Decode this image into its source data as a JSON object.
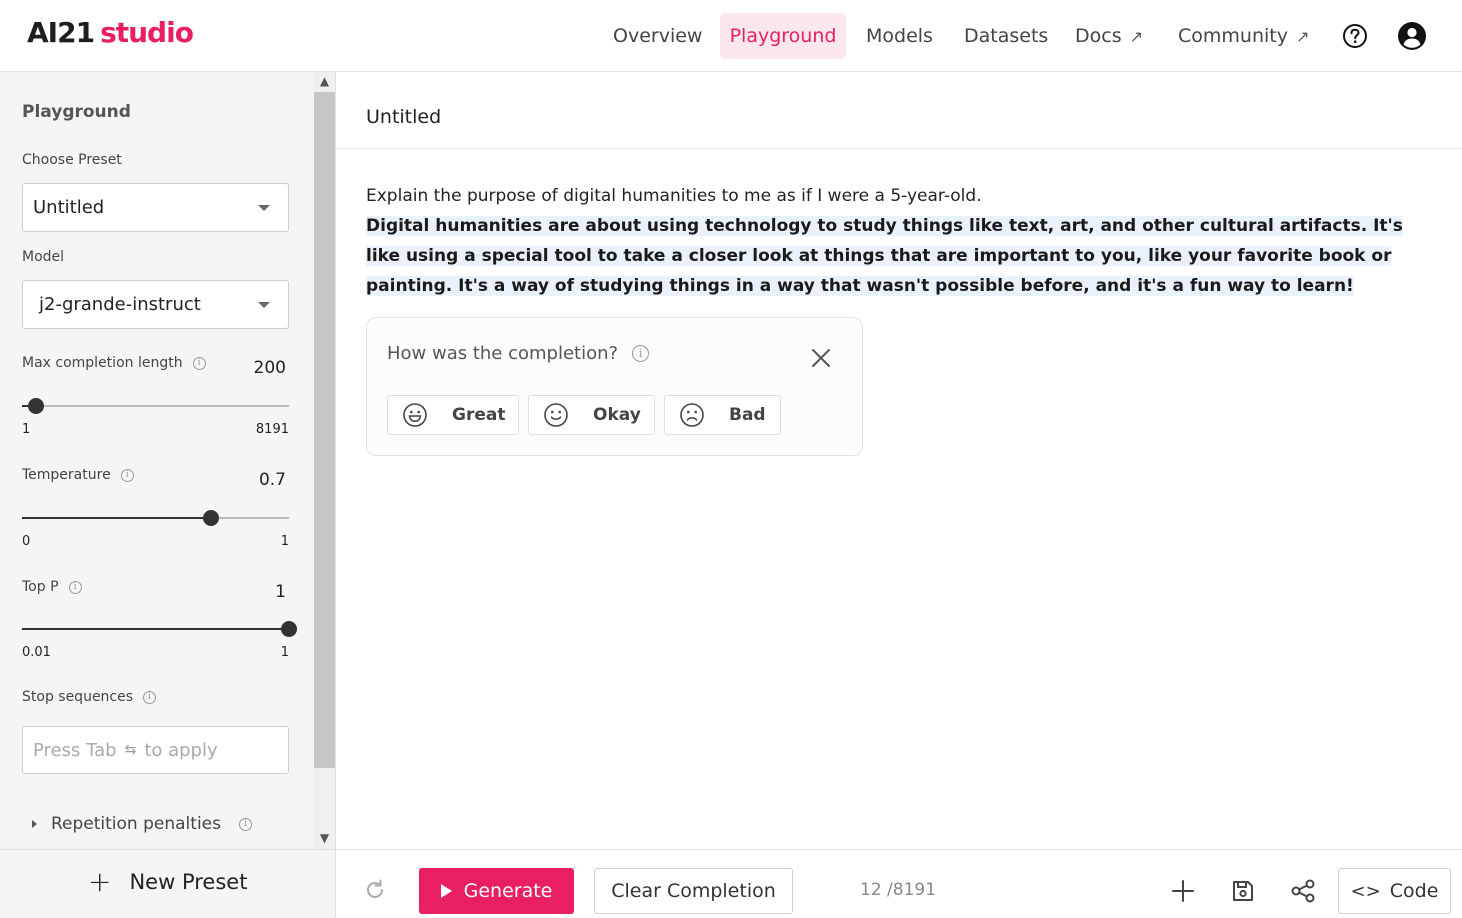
{
  "header": {
    "logo_ai": "AI21",
    "logo_studio": "studio",
    "nav": [
      {
        "label": "Overview",
        "active": false
      },
      {
        "label": "Playground",
        "active": true
      },
      {
        "label": "Models",
        "active": false
      },
      {
        "label": "Datasets",
        "active": false
      },
      {
        "label": "Docs",
        "active": false,
        "external": true
      },
      {
        "label": "Community",
        "active": false,
        "external": true
      }
    ],
    "icons": [
      "help-icon",
      "user-account-icon"
    ],
    "external_glyph": "↗"
  },
  "sidebar": {
    "title": "Playground",
    "preset_label": "Choose Preset",
    "preset_value": "Untitled",
    "model_label": "Model",
    "model_value": "j2-grande-instruct",
    "max_length": {
      "label": "Max completion length",
      "value": "200",
      "min": "1",
      "max": "8191",
      "level": 0.024
    },
    "temperature": {
      "label": "Temperature",
      "value": "0.7",
      "min": "0",
      "max": "1",
      "level": 0.7
    },
    "top_p": {
      "label": "Top P",
      "value": "1",
      "min": "0.01",
      "max": "1",
      "level": 1.0
    },
    "stop_sequences": {
      "label": "Stop sequences",
      "placeholder_pre": "Press Tab",
      "placeholder_post": "to apply"
    },
    "repetition_label": "Repetition penalties",
    "new_preset_label": "New Preset"
  },
  "main": {
    "title": "Untitled",
    "prompt": "Explain the purpose of digital humanities to me as if I were a 5-year-old.",
    "completion": "Digital humanities are about using technology to study things like text, art, and other cultural artifacts. It's like using a special tool to take a closer look at things that are important to you, like your favorite book or painting. It's a way of studying things in a way that wasn't possible before, and it's a fun way to learn!",
    "feedback": {
      "question": "How was the completion?",
      "options": [
        {
          "label": "Great",
          "icon": "grin-face-icon"
        },
        {
          "label": "Okay",
          "icon": "smile-face-icon"
        },
        {
          "label": "Bad",
          "icon": "frown-face-icon"
        }
      ]
    }
  },
  "bottombar": {
    "generate_label": "Generate",
    "clear_label": "Clear Completion",
    "token_count": "12 /8191",
    "code_label": "Code",
    "accent": "#e91e63"
  }
}
